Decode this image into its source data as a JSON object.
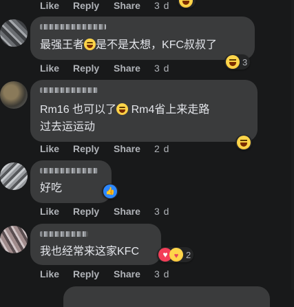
{
  "actions": {
    "like": "Like",
    "reply": "Reply",
    "share": "Share"
  },
  "top_row": {
    "time": "3 d"
  },
  "comments": [
    {
      "text_lines": [
        "最强王者",
        "是不是太想，KFC叔叔了"
      ],
      "reaction_count": "3",
      "time": "3 d"
    },
    {
      "text_lines": [
        "Rm16 也可以了",
        " Rm4省上来走路",
        "过去运运动"
      ],
      "reaction_count": "",
      "time": "2 d"
    },
    {
      "text_lines": [
        "好吃"
      ],
      "reaction_count": "",
      "time": "3 d"
    },
    {
      "text_lines": [
        "我也经常来这家KFC"
      ],
      "reaction_count": "2",
      "time": "3 d"
    }
  ],
  "icons": {
    "haha": "laughing-emoji-icon",
    "like": "thumbs-up-icon",
    "love": "heart-icon",
    "care": "care-emoji-icon"
  },
  "colors": {
    "background": "#18191a",
    "bubble": "#3a3b3c",
    "text": "#e4e6eb",
    "secondary": "#b0b3b8",
    "like_blue": "#2d88ff",
    "love_red": "#f33e58"
  }
}
